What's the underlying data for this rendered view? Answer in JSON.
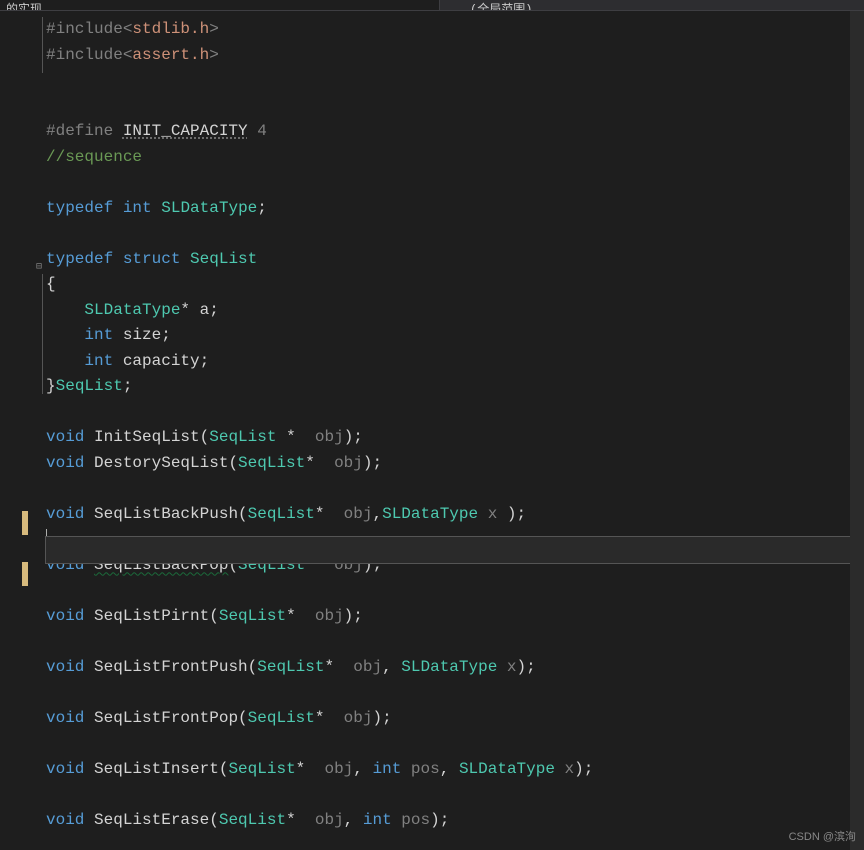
{
  "tabs": {
    "left": "的实现",
    "right": "(全局范围)"
  },
  "code": {
    "inc1_pre": "#include",
    "inc1_lt": "<",
    "inc1_name": "stdlib.h",
    "inc1_gt": ">",
    "inc2_pre": "#include",
    "inc2_lt": "<",
    "inc2_name": "assert.h",
    "inc2_gt": ">",
    "def_pre": "#define ",
    "def_name": "INIT_CAPACITY",
    "def_val": " 4",
    "comment_seq": "//sequence",
    "typedef1": "typedef",
    "int_kw": "int",
    "sldt": "SLDataType",
    "semi": ";",
    "typedef2": "typedef",
    "struct_kw": "struct",
    "seqlist": "SeqList",
    "brace_open": "{",
    "field_a_pre": "    ",
    "field_a_type": "SLDataType",
    "field_a_star": "* ",
    "field_a_name": "a",
    "field_size_pre": "    ",
    "field_size_type": "int",
    "field_size_name": " size",
    "field_cap_pre": "    ",
    "field_cap_type": "int",
    "field_cap_name": " capacity",
    "brace_close": "}",
    "void_kw": "void",
    "fn_init": "InitSeqList",
    "paren_open": "(",
    "paren_close": ")",
    "star": "*",
    "obj_param": " obj",
    "x_param": " x",
    "pos_param": " pos",
    "comma": ",",
    "space_star": " * ",
    "star_space": "* ",
    "fn_destroy": "DestorySeqList",
    "fn_backpush": "SeqListBackPush",
    "fn_backpop": "SeqListBackPop",
    "fn_print": "SeqListPirnt",
    "fn_frontpush": "SeqListFrontPush",
    "fn_frontpop": "SeqListFrontPop",
    "fn_insert": "SeqListInsert",
    "fn_erase": "SeqListErase"
  },
  "watermark": "CSDN @滨洵"
}
